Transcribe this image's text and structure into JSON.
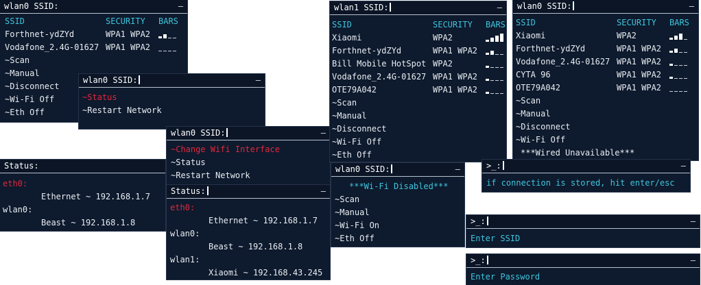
{
  "wifi_a": {
    "title": "wlan0 SSID:",
    "close": "–",
    "headers": [
      "SSID",
      "SECURITY",
      "BARS"
    ],
    "networks": [
      {
        "ssid": "Forthnet-ydZYd",
        "security": "WPA1 WPA2",
        "bars": 2
      },
      {
        "ssid": "Vodafone_2.4G-01627",
        "security": "WPA1 WPA2",
        "bars": 0
      }
    ],
    "menu": [
      "~Scan",
      "~Manual",
      "~Disconnect",
      "~Wi-Fi Off",
      "~Eth Off"
    ]
  },
  "menu_b": {
    "title": "wlan0 SSID:",
    "close": "–",
    "items": [
      "~Status",
      "~Restart Network"
    ]
  },
  "status_a": {
    "title": "Status:",
    "eth_label": "eth0:",
    "eth_value": "Ethernet ~ 192.168.1.7",
    "wlan_label": "wlan0:",
    "wlan_value": "Beast ~ 192.168.1.8"
  },
  "menu_c": {
    "title": "wlan0 SSID:",
    "close": "–",
    "items": [
      "~Change Wifi Interface",
      "~Status",
      "~Restart Network"
    ]
  },
  "status_b": {
    "title": "Status:",
    "close": "–",
    "eth_label": "eth0:",
    "eth_value": "Ethernet ~ 192.168.1.7",
    "wlan0_label": "wlan0:",
    "wlan0_value": "Beast ~ 192.168.1.8",
    "wlan1_label": "wlan1:",
    "wlan1_value": "Xiaomi ~ 192.168.43.245"
  },
  "wifi_b": {
    "title": "wlan1 SSID:",
    "close": "–",
    "headers": [
      "SSID",
      "SECURITY",
      "BARS"
    ],
    "networks": [
      {
        "ssid": "Xiaomi",
        "security": "WPA2",
        "bars": 4
      },
      {
        "ssid": "Forthnet-ydZYd",
        "security": "WPA1 WPA2",
        "bars": 2
      },
      {
        "ssid": "Bill Mobile HotSpot",
        "security": "WPA2",
        "bars": 1
      },
      {
        "ssid": "Vodafone_2.4G-01627",
        "security": "WPA1 WPA2",
        "bars": 1
      },
      {
        "ssid": "OTE79A042",
        "security": "WPA1 WPA2",
        "bars": 1
      }
    ],
    "menu": [
      "~Scan",
      "~Manual",
      "~Disconnect",
      "~Wi-Fi Off",
      "~Eth Off"
    ]
  },
  "wifi_disabled": {
    "title": "wlan0 SSID:",
    "close": "–",
    "notice": "***Wi-Fi Disabled***",
    "menu": [
      "~Scan",
      "~Manual",
      "~Wi-Fi On",
      "~Eth Off"
    ]
  },
  "wifi_c": {
    "title": "wlan0 SSID:",
    "close": "–",
    "headers": [
      "SSID",
      "SECURITY",
      "BARS"
    ],
    "networks": [
      {
        "ssid": "Xiaomi",
        "security": "WPA2",
        "bars": 3
      },
      {
        "ssid": "Forthnet-ydZYd",
        "security": "WPA1 WPA2",
        "bars": 2
      },
      {
        "ssid": "Vodafone_2.4G-01627",
        "security": "WPA1 WPA2",
        "bars": 1
      },
      {
        "ssid": "CYTA 96",
        "security": "WPA1 WPA2",
        "bars": 1
      },
      {
        "ssid": "OTE79A042",
        "security": "WPA1 WPA2",
        "bars": 0
      }
    ],
    "menu": [
      "~Scan",
      "~Manual",
      "~Disconnect",
      "~Wi-Fi Off"
    ],
    "notice": "***Wired Unavailable***"
  },
  "prompt_hint": {
    "title": ">_:",
    "close": "–",
    "text": "if connection is stored, hit enter/esc"
  },
  "prompt_ssid": {
    "title": ">_:",
    "close": "–",
    "text": "Enter SSID"
  },
  "prompt_pass": {
    "title": ">_:",
    "close": "–",
    "text": "Enter Password"
  },
  "colors": {
    "bg": "#0e1a2d",
    "accent": "#3fc5dd",
    "selected": "#e0283e",
    "text": "#e8edf3"
  }
}
